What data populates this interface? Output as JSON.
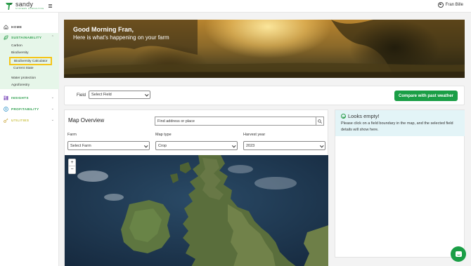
{
  "app": {
    "logo_word": "sandy",
    "logo_tagline": "SYSTEMS CONSULTING",
    "user_name": "Fran Bille"
  },
  "sidebar": {
    "home": "HOME",
    "sustainability": "SUSTAINABILITY",
    "sub_items": {
      "carbon": "Carbon",
      "biodiversity": "Biodiversity",
      "biodiversity_calculator": "Biodiversity Calculator",
      "current_state": "Current State",
      "water_protection": "Water protection",
      "agroforestry": "Agroforestry"
    },
    "insights": "INSIGHTS",
    "profitability": "PROFITABILITY",
    "utilities": "UTILITIES"
  },
  "banner": {
    "greeting": "Good Morning Fran,",
    "subtitle": "Here is what's happening on your farm"
  },
  "field_bar": {
    "label": "Field",
    "select_value": "Select Field",
    "compare_button": "Compare with past weather"
  },
  "map_panel": {
    "title": "Map Overview",
    "search_value": "Find address or place",
    "farm_label": "Farm",
    "farm_value": "Select Farm",
    "map_type_label": "Map type",
    "map_type_value": "Crop",
    "harvest_year_label": "Harvest year",
    "harvest_year_value": "2023",
    "zoom_in": "+",
    "zoom_out": "−"
  },
  "info_panel": {
    "title": "Looks empty!",
    "message": "Please click on a field boundary in the map, and the selected field details will show here."
  },
  "colors": {
    "brand_green": "#1a9e46",
    "sidebar_active_bg": "#e6f6e9",
    "highlight_border": "#f5c518",
    "info_bg": "#e3f4f7",
    "utilities_label": "#c9c040"
  },
  "icons": {
    "logo": "sandy-logo-mark",
    "menu": "hamburger-icon",
    "user": "user-circle-icon",
    "home": "home-icon",
    "sustainability": "leaf-icon",
    "insights": "insights-icon",
    "profitability": "dollar-icon",
    "utilities": "key-icon",
    "search": "search-icon",
    "info": "check-circle-icon",
    "chat": "chat-icon"
  }
}
